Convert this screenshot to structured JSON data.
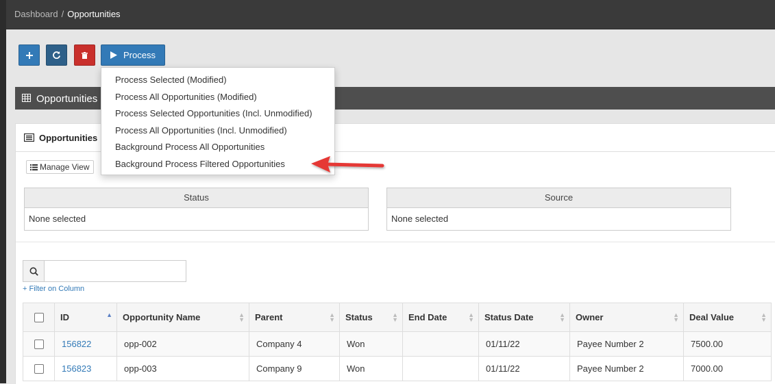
{
  "breadcrumb": {
    "root": "Dashboard",
    "separator": "/",
    "current": "Opportunities"
  },
  "toolbar": {
    "add_icon": "plus-icon",
    "refresh_icon": "refresh-icon",
    "delete_icon": "trash-icon",
    "process_label": "Process"
  },
  "process_menu": {
    "items": [
      "Process Selected (Modified)",
      "Process All Opportunities (Modified)",
      "Process Selected Opportunities (Incl. Unmodified)",
      "Process All Opportunities (Incl. Unmodified)",
      "Background Process All Opportunities",
      "Background Process Filtered Opportunities"
    ]
  },
  "section": {
    "title": "Opportunities",
    "icon": "grid-icon"
  },
  "panel": {
    "tab_label": "Opportunities",
    "manage_view_label": "Manage View"
  },
  "filters": [
    {
      "label": "Status",
      "value": "None selected"
    },
    {
      "label": "Source",
      "value": "None selected"
    }
  ],
  "search": {
    "placeholder": "",
    "filter_link": "+ Filter on Column"
  },
  "table": {
    "columns": [
      "ID",
      "Opportunity Name",
      "Parent",
      "Status",
      "End Date",
      "Status Date",
      "Owner",
      "Deal Value"
    ],
    "rows": [
      {
        "id": "156822",
        "name": "opp-002",
        "parent": "Company 4",
        "status": "Won",
        "end_date": "",
        "status_date": "01/11/22",
        "owner": "Payee Number 2",
        "deal_value": "7500.00"
      },
      {
        "id": "156823",
        "name": "opp-003",
        "parent": "Company 9",
        "status": "Won",
        "end_date": "",
        "status_date": "01/11/22",
        "owner": "Payee Number 2",
        "deal_value": "7000.00"
      }
    ]
  },
  "colors": {
    "primary": "#337ab7",
    "danger": "#c9302c",
    "dark": "#3a3a3a",
    "arrow": "#e53935"
  }
}
